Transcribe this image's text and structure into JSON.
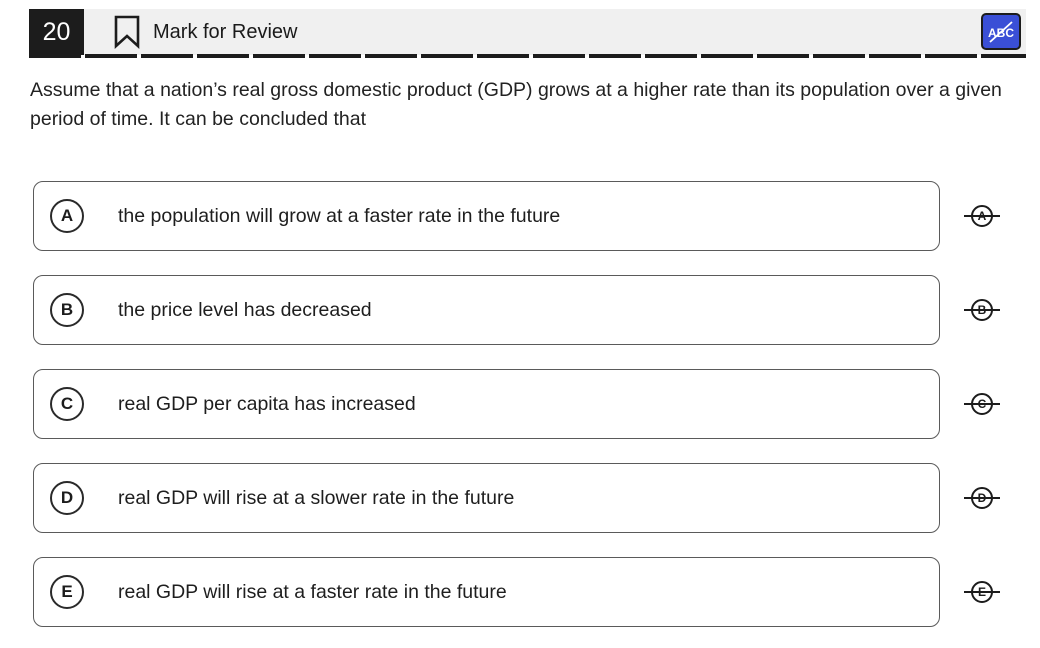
{
  "header": {
    "question_number": "20",
    "mark_label": "Mark for Review",
    "eliminator_label": "ABC"
  },
  "question": {
    "text": "Assume that a nation’s real gross domestic product (GDP) grows at a higher rate than its population over a given period of time. It can be concluded that"
  },
  "choices": [
    {
      "letter": "A",
      "text": "the population will grow at a faster rate in the future"
    },
    {
      "letter": "B",
      "text": "the price level has decreased"
    },
    {
      "letter": "C",
      "text": "real GDP per capita has increased"
    },
    {
      "letter": "D",
      "text": "real GDP will rise at a slower rate in the future"
    },
    {
      "letter": "E",
      "text": "real GDP will rise at a faster rate in the future"
    }
  ],
  "colors": {
    "accent": "#3a4fd6",
    "header_bg": "#f0f0f0",
    "number_bg": "#1c1c1c"
  }
}
